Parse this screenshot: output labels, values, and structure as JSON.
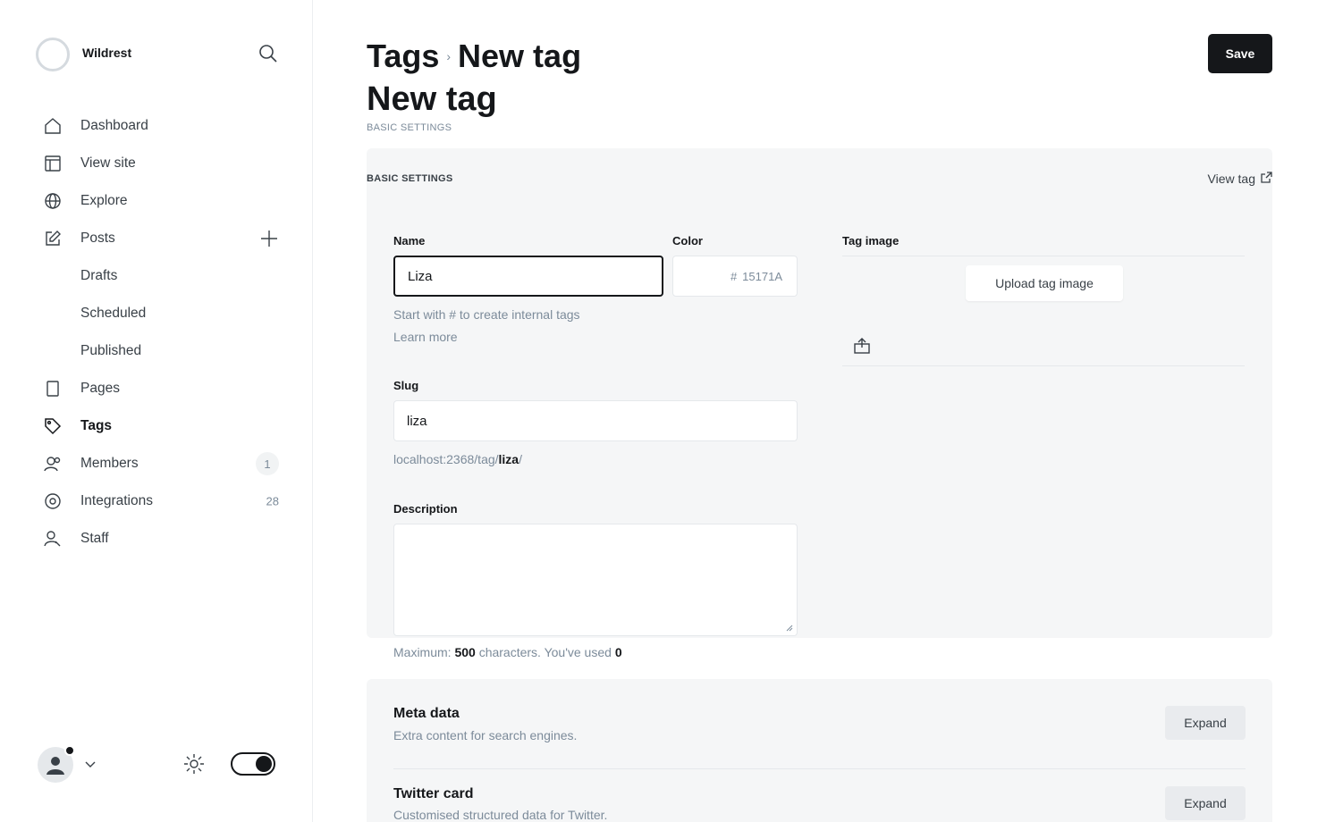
{
  "site": {
    "name": "Wildrest"
  },
  "nav": {
    "dashboard": "Dashboard",
    "view_site": "View site",
    "explore": "Explore",
    "posts": "Posts",
    "drafts": "Drafts",
    "scheduled": "Scheduled",
    "published": "Published",
    "pages": "Pages",
    "tags": "Tags",
    "members": "Members",
    "members_count": "1",
    "integrations": "Integrations",
    "integrations_count": "28",
    "staff": "Staff"
  },
  "header": {
    "breadcrumb_parent": "Tags",
    "breadcrumb_sep": "›",
    "breadcrumb_current": "New tag",
    "save_label": "Save",
    "title": "New tag",
    "section_kicker": "BASIC SETTINGS"
  },
  "form": {
    "card_kicker": "BASIC SETTINGS",
    "view_tag": "View tag",
    "name_label": "Name",
    "name_value": "Liza",
    "color_label": "Color",
    "color_hash": "#",
    "color_value": "15171A",
    "name_hint": "Start with # to create internal tags",
    "learn_more": "Learn more",
    "slug_label": "Slug",
    "slug_value": "liza",
    "slug_url_prefix": "localhost:2368/tag/",
    "slug_url_slug": "liza",
    "slug_url_suffix": "/",
    "description_label": "Description",
    "description_value": "",
    "desc_hint_prefix": "Maximum: ",
    "desc_hint_max": "500",
    "desc_hint_mid": " characters. You've used ",
    "desc_hint_used": "0",
    "image_label": "Tag image",
    "upload_label": "Upload tag image"
  },
  "sections": {
    "meta_title": "Meta data",
    "meta_sub": "Extra content for search engines.",
    "twitter_title": "Twitter card",
    "twitter_sub": "Customised structured data for Twitter.",
    "expand_label": "Expand"
  },
  "colors": {
    "accent": "#15171A",
    "muted": "#7C8B9A",
    "panel": "#F5F6F7"
  },
  "icons": [
    "search-icon",
    "home-icon",
    "browser-icon",
    "globe-icon",
    "edit-icon",
    "plus-icon",
    "page-icon",
    "tag-icon",
    "members-icon",
    "integrations-icon",
    "staff-icon",
    "gear-icon",
    "chevron-down-icon",
    "external-link-icon",
    "image-icon"
  ]
}
